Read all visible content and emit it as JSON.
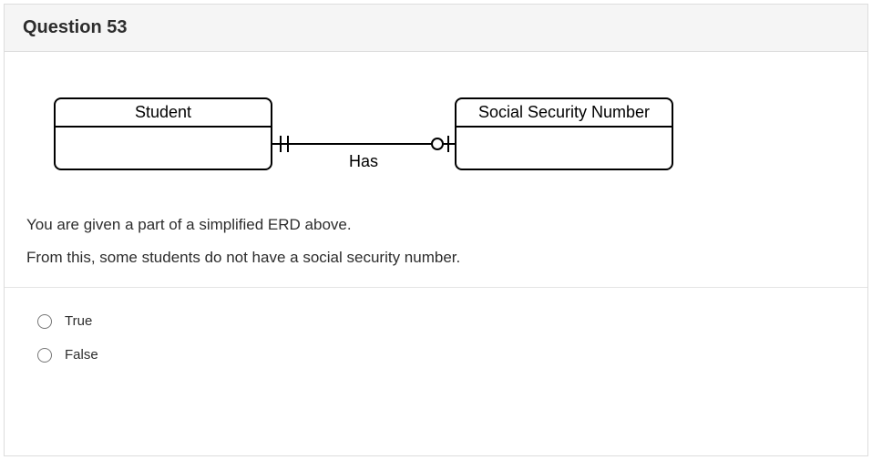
{
  "header": {
    "title": "Question 53"
  },
  "erd": {
    "entity_left": "Student",
    "entity_right": "Social Security Number",
    "relationship_label": "Has"
  },
  "body": {
    "line1": "You are given a part of a simplified ERD above.",
    "line2": "From this, some students do not have a social security number."
  },
  "options": {
    "true_label": "True",
    "false_label": "False"
  }
}
